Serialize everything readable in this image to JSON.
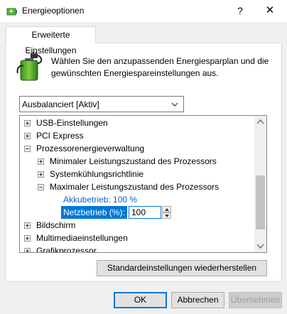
{
  "window": {
    "title": "Energieoptionen",
    "help_label": "?",
    "close_label": "✕"
  },
  "tab": {
    "label": "Erweiterte Einstellungen"
  },
  "description": "Wählen Sie den anzupassenden Energiesparplan und die gewünschten Energiespareinstellungen aus.",
  "plan_select": {
    "value": "Ausbalanciert [Aktiv]"
  },
  "tree": {
    "usb": "USB-Einstellungen",
    "pci": "PCI Express",
    "processor": "Prozessorenergieverwaltung",
    "min_state": "Minimaler Leistungszustand des Prozessors",
    "cooling": "Systemkühlungsrichtlinie",
    "max_state": "Maximaler Leistungszustand des Prozessors",
    "battery_label": "Akkubetrieb:",
    "battery_value": "100 %",
    "ac_label": "Netzbetrieb (%):",
    "ac_value": "100",
    "display": "Bildschirm",
    "multimedia": "Multimediaeinstellungen",
    "graphics": "Grafikprozessor"
  },
  "buttons": {
    "restore": "Standardeinstellungen wiederherstellen",
    "ok": "OK",
    "cancel": "Abbrechen",
    "apply": "Übernehmen"
  },
  "colors": {
    "accent": "#0078d7",
    "value_text": "#0a64c8"
  }
}
